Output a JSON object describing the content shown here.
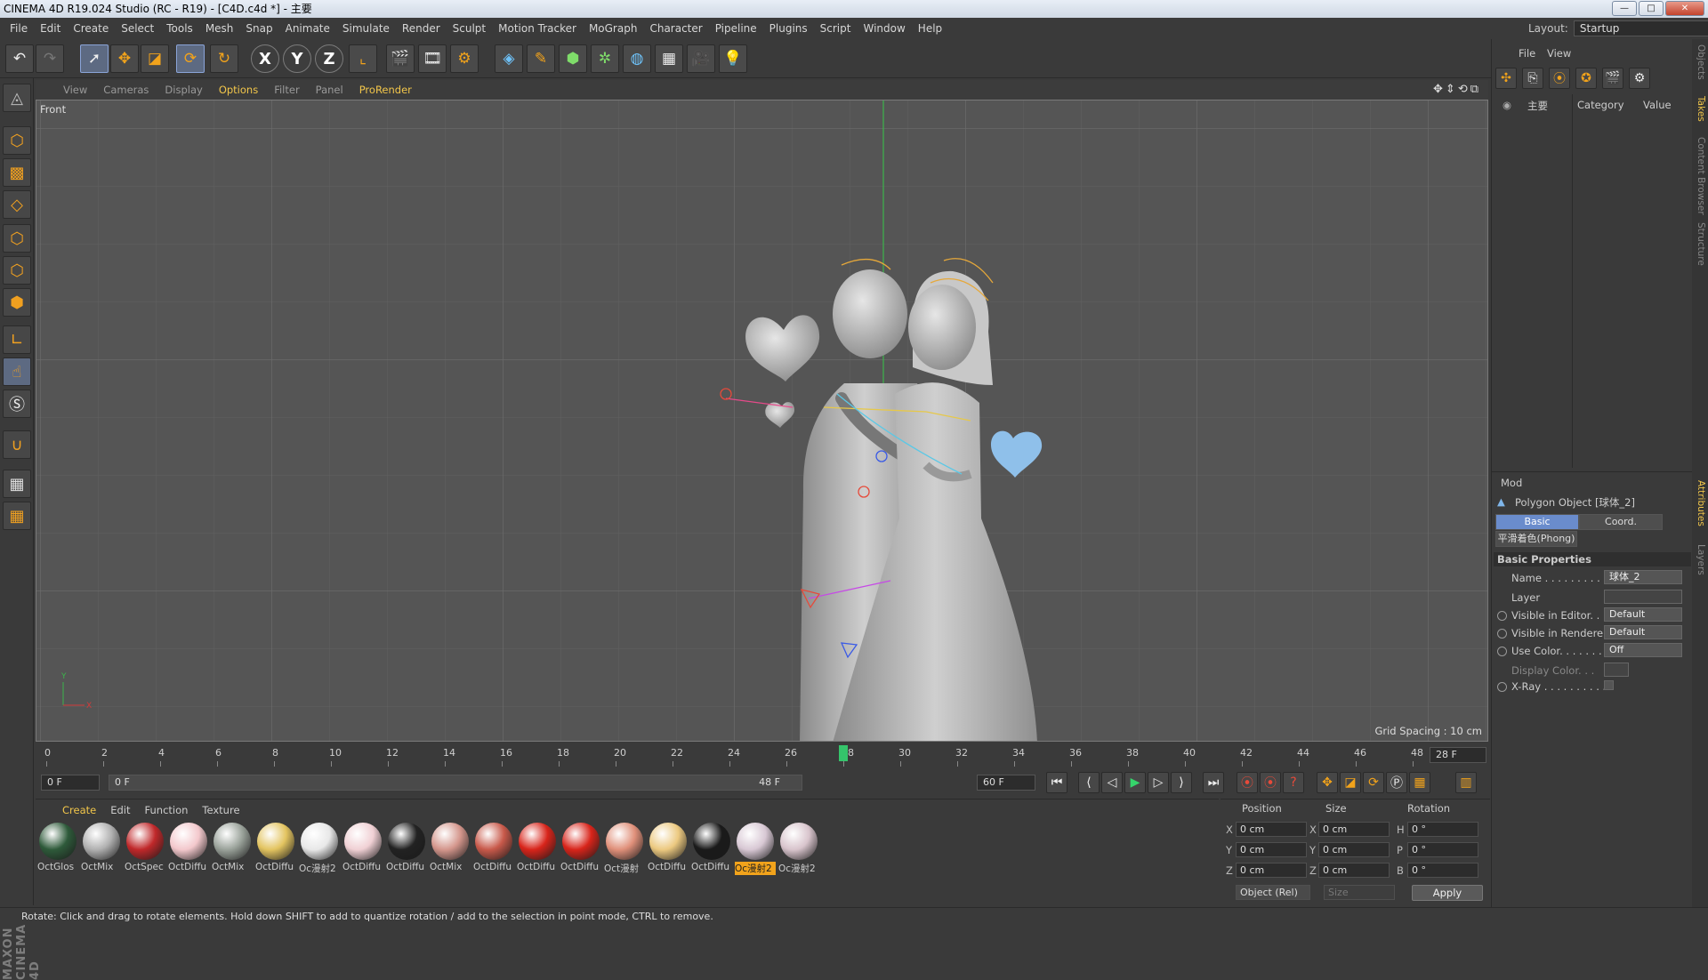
{
  "window": {
    "title": "CINEMA 4D R19.024 Studio (RC - R19) - [C4D.c4d *] - 主要"
  },
  "menubar": {
    "items": [
      "File",
      "Edit",
      "Create",
      "Select",
      "Tools",
      "Mesh",
      "Snap",
      "Animate",
      "Simulate",
      "Render",
      "Sculpt",
      "Motion Tracker",
      "MoGraph",
      "Character",
      "Pipeline",
      "Plugins",
      "Script",
      "Window",
      "Help"
    ],
    "layout_label": "Layout:",
    "layout_value": "Startup"
  },
  "toolbar": {
    "icons": [
      "undo-icon",
      "redo-icon",
      "live-select-icon",
      "move-icon",
      "scale-icon",
      "rotate-icon",
      "recent-tool-icon",
      "x-axis-icon",
      "y-axis-icon",
      "z-axis-icon",
      "coordinate-system-icon",
      "render-view-icon",
      "render-picture-viewer-icon",
      "edit-render-settings-icon",
      "cube-icon",
      "pen-icon",
      "subdivision-icon",
      "cloner-icon",
      "deformer-icon",
      "floor-icon",
      "camera-icon",
      "light-icon"
    ],
    "axis_labels": [
      "X",
      "Y",
      "Z"
    ]
  },
  "viewport": {
    "menu": [
      "View",
      "Cameras",
      "Display",
      "Options",
      "Filter",
      "Panel",
      "ProRender"
    ],
    "label": "Front",
    "grid_spacing": "Grid Spacing : 10 cm"
  },
  "timeline": {
    "ticks": [
      "0",
      "2",
      "4",
      "6",
      "8",
      "10",
      "12",
      "14",
      "16",
      "18",
      "20",
      "22",
      "24",
      "26",
      "28",
      "30",
      "32",
      "34",
      "36",
      "38",
      "40",
      "42",
      "44",
      "46",
      "48"
    ],
    "current_frame": "28 F",
    "current_frame_value": 28
  },
  "transport": {
    "start": "0 F",
    "range_start": "0 F",
    "range_end": "48 F",
    "end": "60 F"
  },
  "materials": {
    "menu": [
      "Create",
      "Edit",
      "Function",
      "Texture"
    ],
    "items": [
      {
        "label": "OctGlos",
        "color": "#2e5a3a"
      },
      {
        "label": "OctMix",
        "color": "#b0b0b0"
      },
      {
        "label": "OctSpec",
        "color": "#c0282a"
      },
      {
        "label": "OctDiffu",
        "color": "#f3c8cc"
      },
      {
        "label": "OctMix",
        "color": "#9aa29a"
      },
      {
        "label": "OctDiffu",
        "color": "#e3c460"
      },
      {
        "label": "Oc漫射2",
        "color": "#e8e8e8"
      },
      {
        "label": "OctDiffu",
        "color": "#f0d0d4"
      },
      {
        "label": "OctDiffu",
        "color": "#222222"
      },
      {
        "label": "OctMix",
        "color": "#d4968c"
      },
      {
        "label": "OctDiffu",
        "color": "#c8594a"
      },
      {
        "label": "OctDiffu",
        "color": "#d8241a"
      },
      {
        "label": "OctDiffu",
        "color": "#d8241a"
      },
      {
        "label": "Oct漫射",
        "color": "#e0907a"
      },
      {
        "label": "OctDiffu",
        "color": "#ecc980"
      },
      {
        "label": "OctDiffu",
        "color": "#1a1a1a"
      },
      {
        "label": "Oc漫射2",
        "color": "#d8c8d4"
      },
      {
        "label": "Oc漫射2",
        "color": "#d8c4cc"
      }
    ]
  },
  "coordinates": {
    "headers": [
      "Position",
      "Size",
      "Rotation"
    ],
    "rows": [
      {
        "axis": "X",
        "pos": "0 cm",
        "size_axis": "X",
        "size": "0 cm",
        "rot_axis": "H",
        "rot": "0 °"
      },
      {
        "axis": "Y",
        "pos": "0 cm",
        "size_axis": "Y",
        "size": "0 cm",
        "rot_axis": "P",
        "rot": "0 °"
      },
      {
        "axis": "Z",
        "pos": "0 cm",
        "size_axis": "Z",
        "size": "0 cm",
        "rot_axis": "B",
        "rot": "0 °"
      }
    ],
    "mode": "Object (Rel)",
    "size_mode": "Size",
    "apply": "Apply"
  },
  "objects": {
    "menu": [
      "File",
      "View"
    ],
    "root_label": "主要",
    "columns": [
      "Category",
      "Value"
    ]
  },
  "attributes": {
    "mode": "Mod",
    "object_title": "Polygon Object [球体_2]",
    "tabs": [
      "Basic",
      "Coord."
    ],
    "phong_tab": "平滑着色(Phong)",
    "section": "Basic Properties",
    "props": [
      {
        "label": "Name . . . . . . . . . . .",
        "value": "球体_2"
      },
      {
        "label": "Layer",
        "value": ""
      },
      {
        "label": "Visible in Editor. . .",
        "value": "Default"
      },
      {
        "label": "Visible in Renderer",
        "value": "Default"
      },
      {
        "label": "Use Color. . . . . . .",
        "value": "Off"
      },
      {
        "label": "Display Color. . .",
        "value": ""
      },
      {
        "label": "X-Ray . . . . . . . . . .",
        "value": ""
      }
    ]
  },
  "side_tabs": [
    "Objects",
    "Takes",
    "Content Browser",
    "Structure",
    "Attributes",
    "Layers"
  ],
  "status": {
    "text": "Rotate: Click and drag to rotate elements. Hold down SHIFT to add to quantize rotation / add to the selection in point mode, CTRL to remove."
  },
  "branding": {
    "text": "MAXON CINEMA 4D"
  }
}
